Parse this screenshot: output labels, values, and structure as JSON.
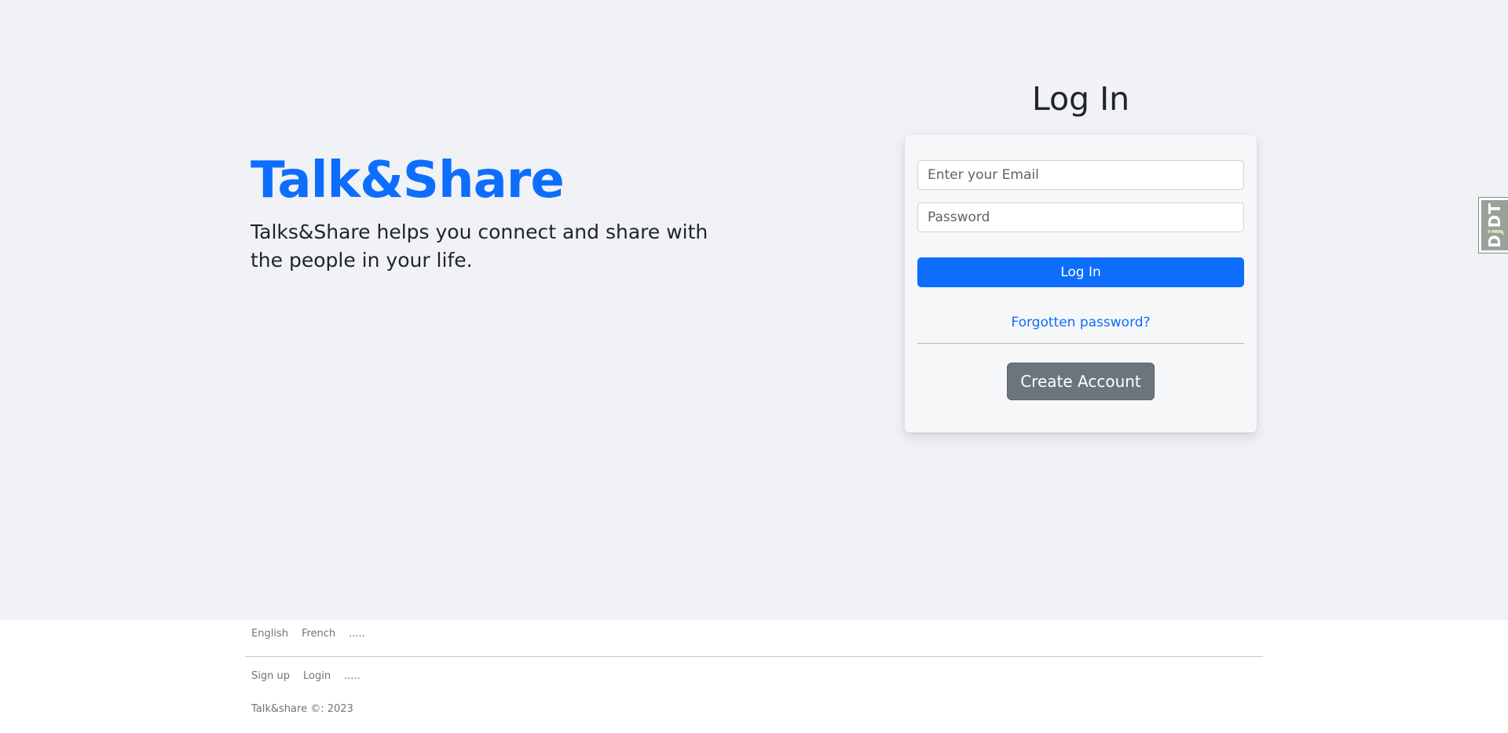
{
  "brand": {
    "title": "Talk&Share",
    "tagline": "Talks&Share helps you connect and share with the people in your life."
  },
  "login": {
    "heading": "Log In",
    "email_placeholder": "Enter your Email",
    "password_placeholder": "Password",
    "submit_label": "Log In",
    "forgot_label": "Forgotten password?",
    "create_label": "Create Account"
  },
  "ddt": {
    "d_letter": "D",
    "j_letter": "j",
    "dt_letters": "DT"
  },
  "footer": {
    "languages": [
      "English",
      "French",
      "....."
    ],
    "links": [
      "Sign up",
      "Login",
      "....."
    ],
    "copyright": "Talk&share ©: 2023"
  },
  "colors": {
    "accent": "#0d6efd",
    "hero_background": "#f0f2f5",
    "secondary_button": "#6c757d"
  }
}
